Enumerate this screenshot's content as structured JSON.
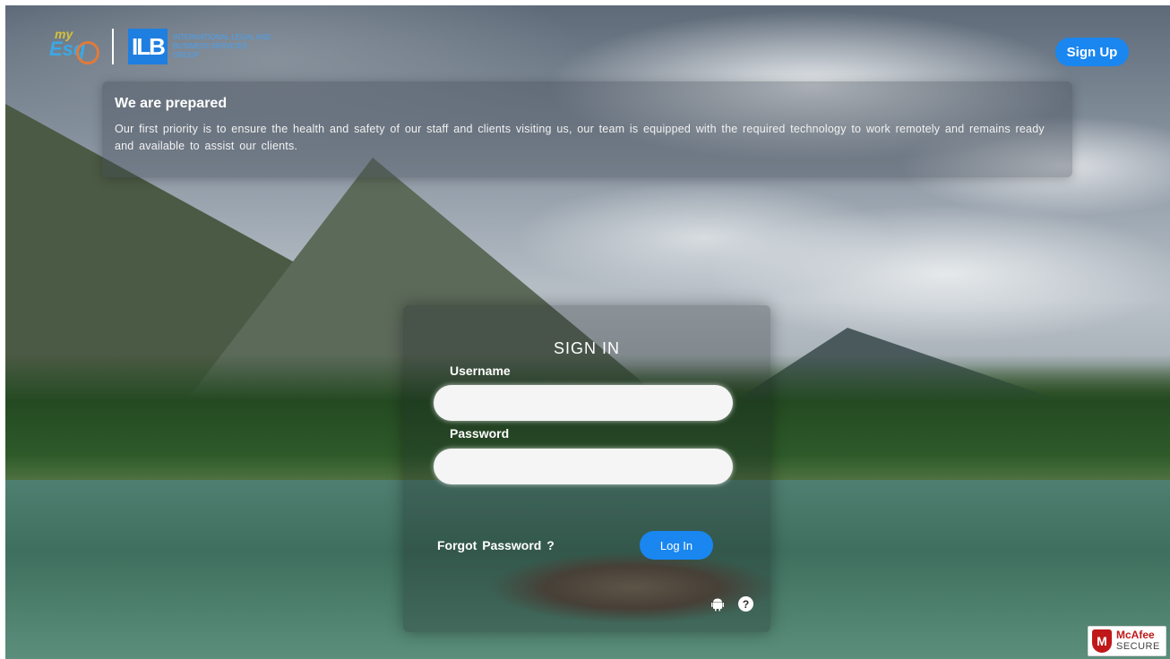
{
  "header": {
    "logo_my": "my",
    "logo_esq": "Esq",
    "logo_ilb_mark": "ILB",
    "logo_ilb_name": "INTERNATIONAL LEGAL AND BUSINESS SERVICES GROUP",
    "signup_label": "Sign Up"
  },
  "notice": {
    "title": "We are prepared",
    "text": "Our first priority is to ensure the health and safety of our staff and clients visiting us, our team is equipped with the required technology to work remotely and remains ready and available to assist our clients."
  },
  "signin": {
    "title": "SIGN IN",
    "username_label": "Username",
    "username_value": "",
    "password_label": "Password",
    "password_value": "",
    "forgot_label": "Forgot Password ?",
    "login_label": "Log In",
    "help_glyph": "?"
  },
  "badge": {
    "brand": "McAfee",
    "secure": "SECURE"
  },
  "colors": {
    "accent": "#1a86f0"
  },
  "icons": [
    "android-icon",
    "help-icon",
    "mcafee-shield-icon"
  ]
}
